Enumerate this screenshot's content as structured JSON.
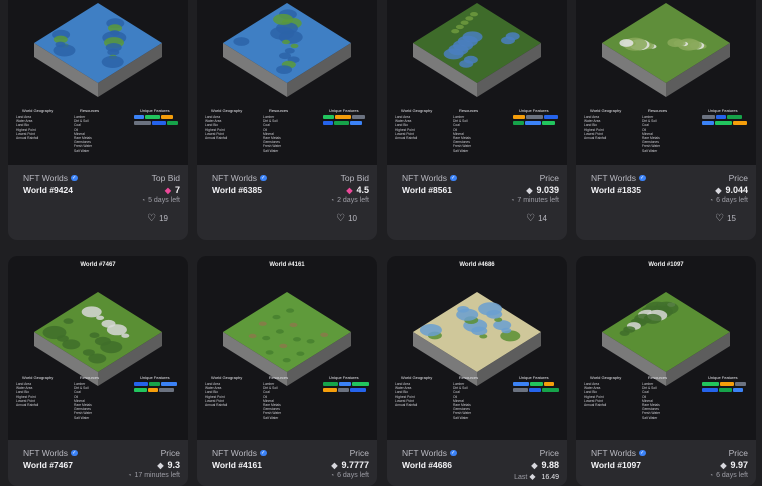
{
  "collection": "NFT Worlds",
  "panel": {
    "geo_header": "World Geography",
    "res_header": "Resources",
    "uniq_header": "Unique Features",
    "geo_lines": [
      "Land Area",
      "Water Area",
      "Land Bio",
      "Highest Point",
      "Lowest Point",
      "Annual Rainfall"
    ],
    "res_lines": [
      "Lumber",
      "Dirt & Soil",
      "Coal",
      "Oil",
      "Mineral",
      "Rare Metals",
      "Gemstones",
      "Fresh Water",
      "Salt Water"
    ]
  },
  "cards": [
    {
      "name": "World #9424",
      "label": "Top Bid",
      "price": "7",
      "eth_color": "#ec4899",
      "time": "5 days left",
      "likes": "19",
      "map": "water"
    },
    {
      "name": "World #6385",
      "label": "Top Bid",
      "price": "4.5",
      "eth_color": "#ec4899",
      "time": "2 days left",
      "likes": "10",
      "map": "water"
    },
    {
      "name": "World #8561",
      "label": "Price",
      "price": "9.039",
      "eth_color": "#d7d7dd",
      "time": "7 minutes left",
      "likes": "14",
      "map": "forest"
    },
    {
      "name": "World #1835",
      "label": "Price",
      "price": "9.044",
      "eth_color": "#d7d7dd",
      "time": "6 days left",
      "likes": "15",
      "map": "snow"
    },
    {
      "title": "World #7467",
      "name": "World #7467",
      "label": "Price",
      "price": "9.3",
      "eth_color": "#d7d7dd",
      "time": "17 minutes left",
      "map": "mountain"
    },
    {
      "title": "World #4161",
      "name": "World #4161",
      "label": "Price",
      "price": "9.7777",
      "eth_color": "#d7d7dd",
      "time": "6 days left",
      "map": "grass"
    },
    {
      "title": "World #4686",
      "name": "World #4686",
      "label": "Price",
      "price": "9.88",
      "eth_color": "#d7d7dd",
      "last_label": "Last",
      "last_value": "16.49",
      "map": "desert"
    },
    {
      "title": "World #1097",
      "name": "World #1097",
      "label": "Price",
      "price": "9.97",
      "eth_color": "#d7d7dd",
      "time": "6 days left",
      "map": "mountain"
    }
  ],
  "map_colors": {
    "water": [
      "#3f7fc4",
      "#5a9a3a",
      "#2c63a8"
    ],
    "forest": [
      "#3e6b2a",
      "#6e9a3e",
      "#4a7fc0"
    ],
    "snow": [
      "#5f8e3a",
      "#e6e6e6",
      "#8aa95a"
    ],
    "mountain": [
      "#5a8f34",
      "#d8d8d8",
      "#3f6f2a"
    ],
    "grass": [
      "#5f9a3b",
      "#8a7a4a",
      "#46802f"
    ],
    "desert": [
      "#cfc79a",
      "#5a8f34",
      "#6a9fd0"
    ],
    "side": [
      "#7a7a7a",
      "#5d5d5d"
    ]
  }
}
